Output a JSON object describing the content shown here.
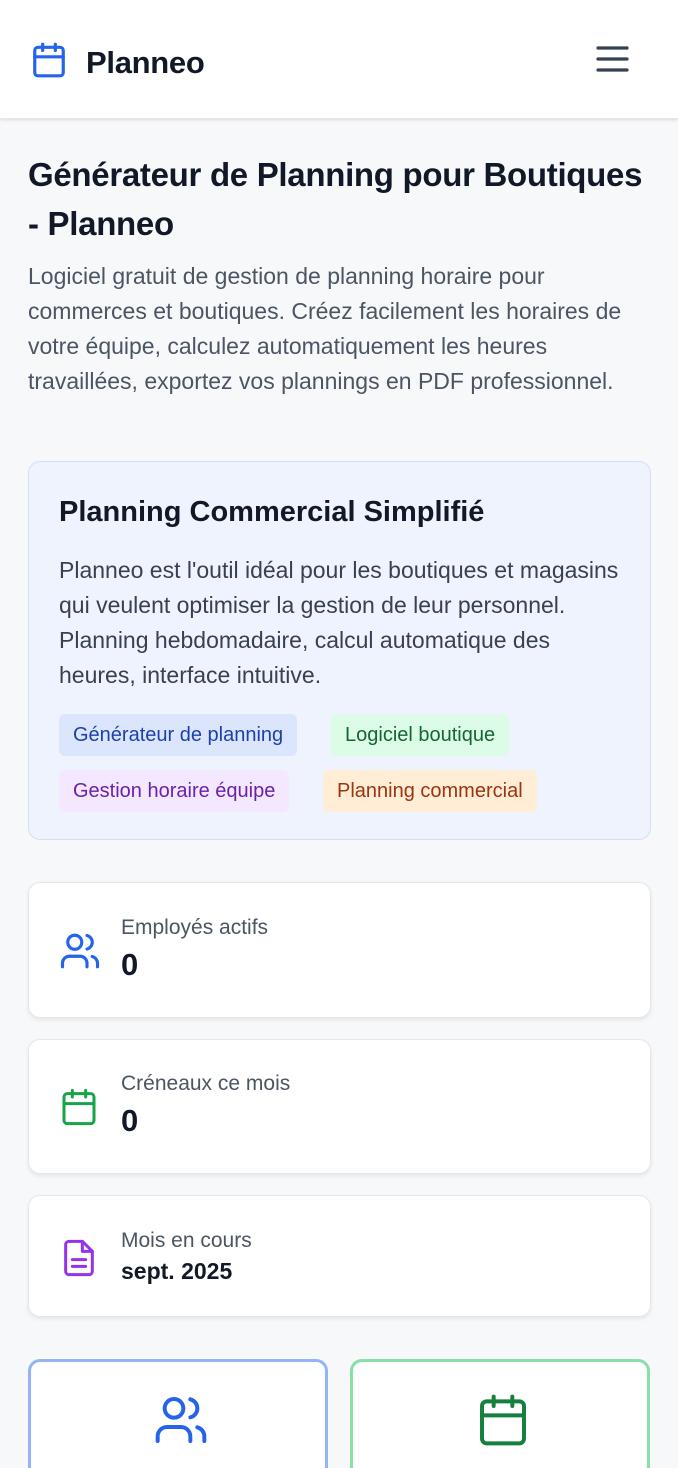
{
  "app": {
    "name": "Planneo",
    "logo_icon": "calendar-icon",
    "menu_icon": "hamburger-menu-icon"
  },
  "hero": {
    "title": "Générateur de Planning pour Boutiques - Planneo",
    "description": "Logiciel gratuit de gestion de planning horaire pour commerces et boutiques. Créez facilement les horaires de votre équipe, calculez automatiquement les heures travaillées, exportez vos plannings en PDF professionnel."
  },
  "info": {
    "title": "Planning Commercial Simplifié",
    "text": "Planneo est l'outil idéal pour les boutiques et magasins qui veulent optimiser la gestion de leur personnel. Planning hebdomadaire, calcul automatique des heures, interface intuitive.",
    "tags": [
      {
        "label": "Générateur de planning",
        "bg": "#dbe6fd",
        "color": "#1e40af"
      },
      {
        "label": "Logiciel boutique",
        "bg": "#dcfce7",
        "color": "#166534"
      },
      {
        "label": "Gestion horaire équipe",
        "bg": "#f3e8ff",
        "color": "#6b21a8"
      },
      {
        "label": "Planning commercial",
        "bg": "#ffedd5",
        "color": "#9a3412"
      }
    ]
  },
  "stats": [
    {
      "label": "Employés actifs",
      "value": "0",
      "icon": "users-icon",
      "color": "#2563eb"
    },
    {
      "label": "Créneaux ce mois",
      "value": "0",
      "icon": "calendar-icon",
      "color": "#16a34a"
    },
    {
      "label": "Mois en cours",
      "value": "sept. 2025",
      "icon": "document-icon",
      "color": "#9333ea"
    }
  ],
  "actions": [
    {
      "icon": "users-icon",
      "color": "#2563eb",
      "border": "#93b4f8"
    },
    {
      "icon": "calendar-icon",
      "color": "#15803d",
      "border": "#86e0a8"
    }
  ],
  "colors": {
    "accent": "#2563eb",
    "background": "#f7f8fa"
  }
}
